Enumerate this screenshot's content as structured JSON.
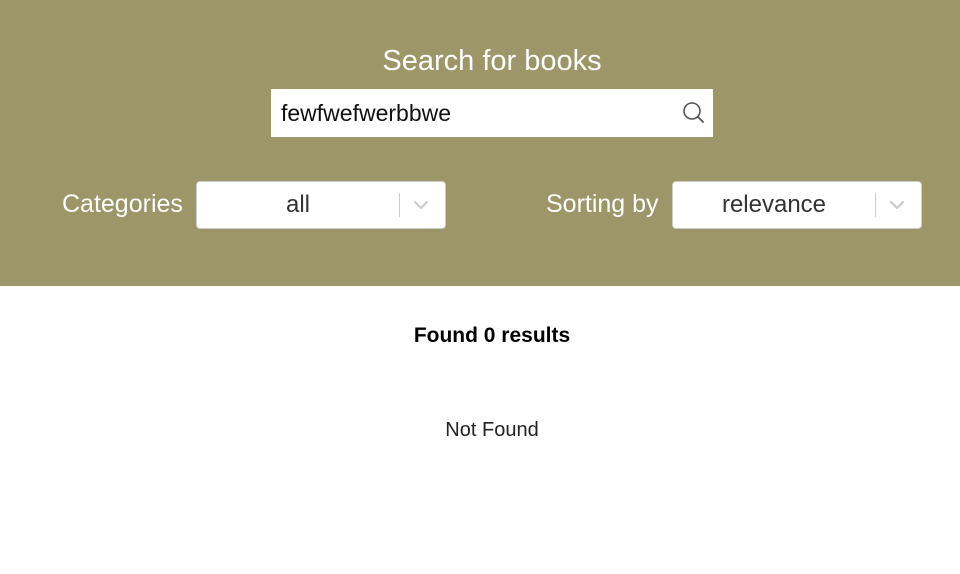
{
  "header": {
    "title": "Search for books",
    "background_color": "#9d9668"
  },
  "search": {
    "value": "fewfwefwerbbwe",
    "icon": "search-icon"
  },
  "filters": {
    "categories_label": "Categories",
    "categories_value": "all",
    "sorting_label": "Sorting by",
    "sorting_value": "relevance",
    "dropdown_icon": "chevron-down-icon"
  },
  "results": {
    "count_text": "Found 0 results",
    "empty_text": "Not Found"
  }
}
